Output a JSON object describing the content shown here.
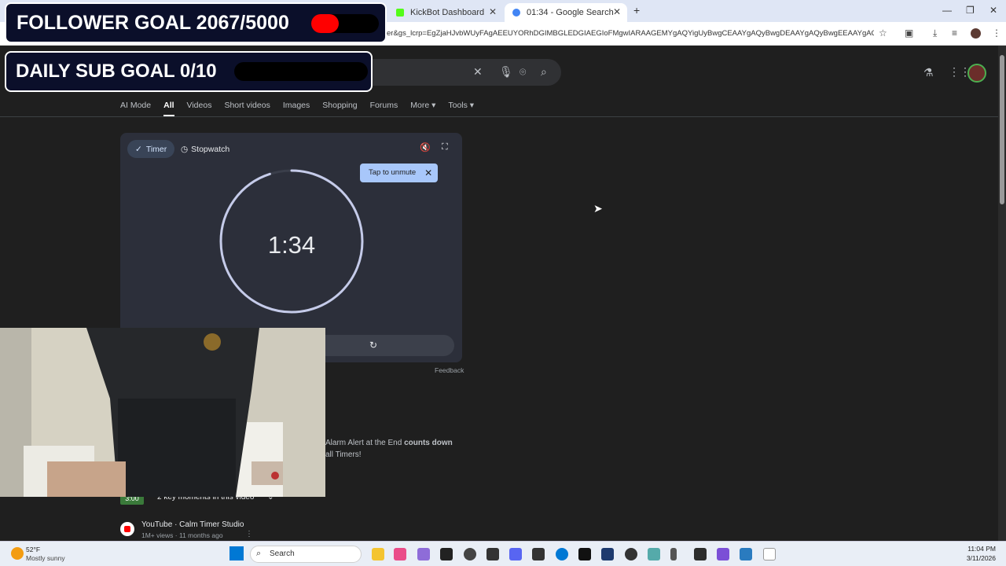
{
  "browser": {
    "tabs": [
      {
        "title": "KickBot Dashboard"
      },
      {
        "title": "01:34 - Google Search"
      }
    ],
    "url": "er&gs_lcrp=EgZjaHJvbWUyFAgAEEUYORhDGIMBGLEDGIAEGIoFMgwIARAAGEMYgAQYigUyBwgCEAAYgAQyBwgDEAAYgAQyBwgEEAAYgAQyBwgFEA..."
  },
  "google": {
    "nav_tabs": [
      "AI Mode",
      "All",
      "Videos",
      "Short videos",
      "Images",
      "Shopping",
      "Forums",
      "More",
      "Tools"
    ],
    "timer": {
      "timer_label": "Timer",
      "stopwatch_label": "Stopwatch",
      "tooltip": "Tap to unmute",
      "time": "1:34",
      "progress_fraction": 0.95
    },
    "feedback": "Feedback",
    "result": {
      "desc_line1_a": "Alarm Alert at the End ",
      "desc_line1_b": "counts down",
      "desc_line2": "all Timers!",
      "badge": "3:00",
      "moments": "2 key moments in this video",
      "source": "YouTube · Calm Timer Studio",
      "meta": "1M+ views · 11 months ago"
    }
  },
  "overlay": {
    "follower_goal": "FOLLOWER GOAL 2067/5000",
    "follower_progress": 0.41,
    "sub_goal": "DAILY SUB GOAL 0/10",
    "sub_progress": 0
  },
  "taskbar": {
    "weather_temp": "52°F",
    "weather_desc": "Mostly sunny",
    "search_label": "Search",
    "time": "11:04 PM",
    "date": "3/11/2026"
  },
  "colors": {
    "overlay_bg": "#0b0f2a",
    "progress_red": "#ff0000",
    "timer_arc": "#c5cbe9"
  }
}
